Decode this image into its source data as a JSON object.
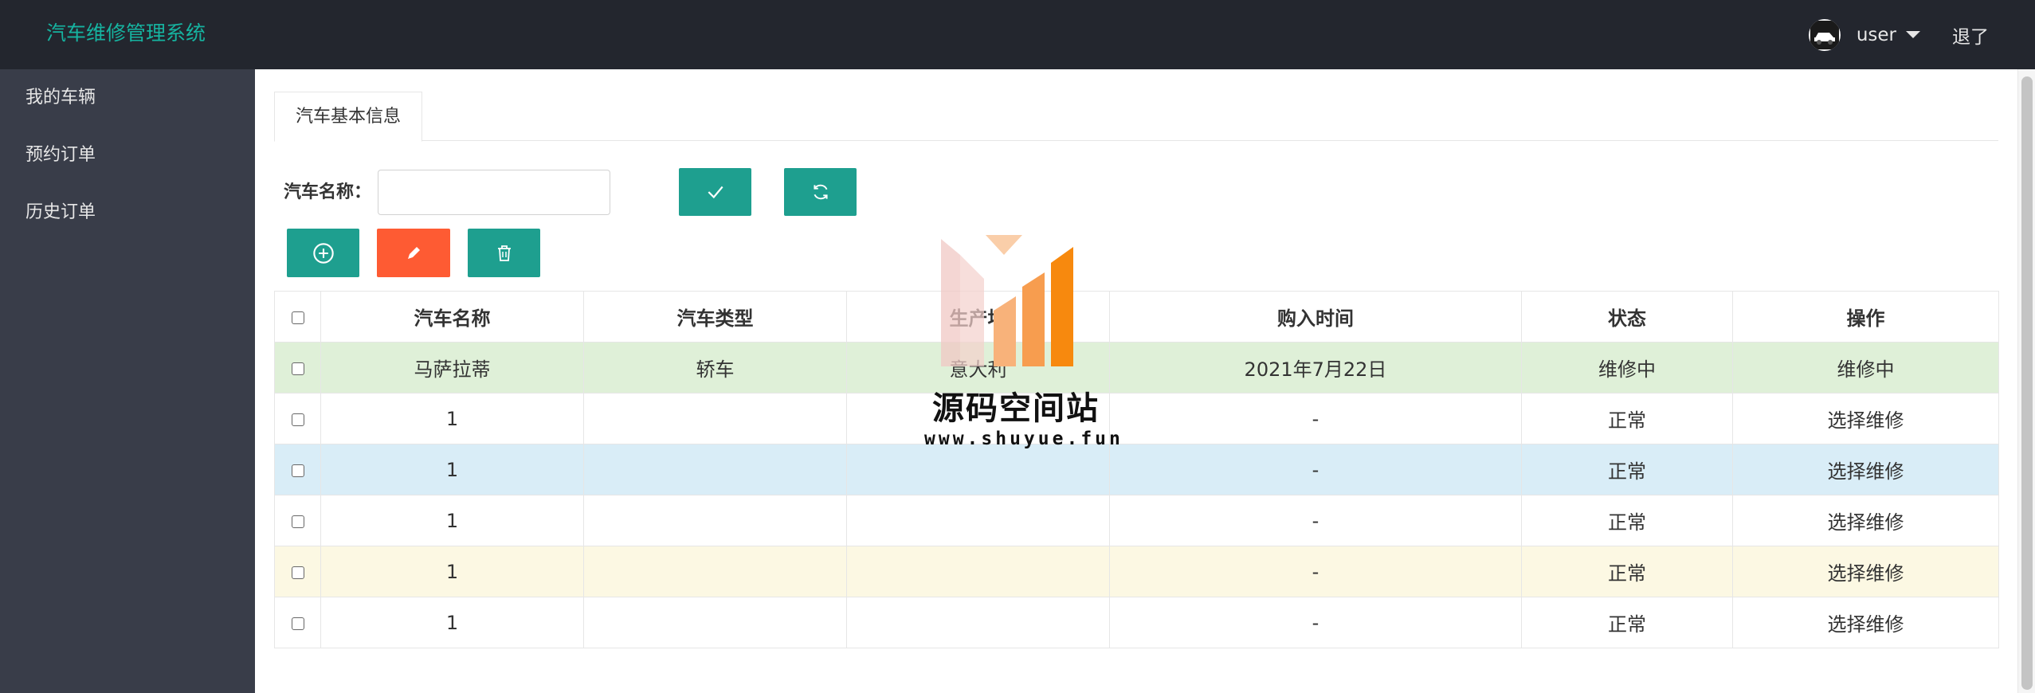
{
  "app": {
    "title": "汽车维修管理系统"
  },
  "header": {
    "username": "user",
    "logout_label": "退了"
  },
  "sidebar": {
    "items": [
      {
        "label": "我的车辆"
      },
      {
        "label": "预约订单"
      },
      {
        "label": "历史订单"
      }
    ]
  },
  "main": {
    "tab_label": "汽车基本信息",
    "search": {
      "label": "汽车名称：",
      "value": "",
      "placeholder": ""
    },
    "buttons": {
      "confirm": "check-icon",
      "refresh": "refresh-icon",
      "add": "plus-circle-icon",
      "edit": "pencil-icon",
      "delete": "trash-icon"
    },
    "table": {
      "headers": [
        "汽车名称",
        "汽车类型",
        "生产地",
        "购入时间",
        "状态",
        "操作"
      ],
      "rows": [
        {
          "name": "马萨拉蒂",
          "type": "轿车",
          "origin": "意大利",
          "purchase": "2021年7月22日",
          "status": "维修中",
          "action": "维修中"
        },
        {
          "name": "1",
          "type": "",
          "origin": "",
          "purchase": "-",
          "status": "正常",
          "action": "选择维修"
        },
        {
          "name": "1",
          "type": "",
          "origin": "",
          "purchase": "-",
          "status": "正常",
          "action": "选择维修"
        },
        {
          "name": "1",
          "type": "",
          "origin": "",
          "purchase": "-",
          "status": "正常",
          "action": "选择维修"
        },
        {
          "name": "1",
          "type": "",
          "origin": "",
          "purchase": "-",
          "status": "正常",
          "action": "选择维修"
        },
        {
          "name": "1",
          "type": "",
          "origin": "",
          "purchase": "-",
          "status": "正常",
          "action": "选择维修"
        }
      ]
    }
  },
  "watermark": {
    "title": "源码空间站",
    "url": "www.shuyue.fun"
  },
  "colors": {
    "header_bg": "#23262e",
    "sidebar_bg": "#393d49",
    "accent_teal": "#1e9f8f",
    "accent_orange": "#fe5b33",
    "logo_text": "#16b3a0",
    "status_red": "#ff0000",
    "link_blue": "#2d8cf0"
  }
}
